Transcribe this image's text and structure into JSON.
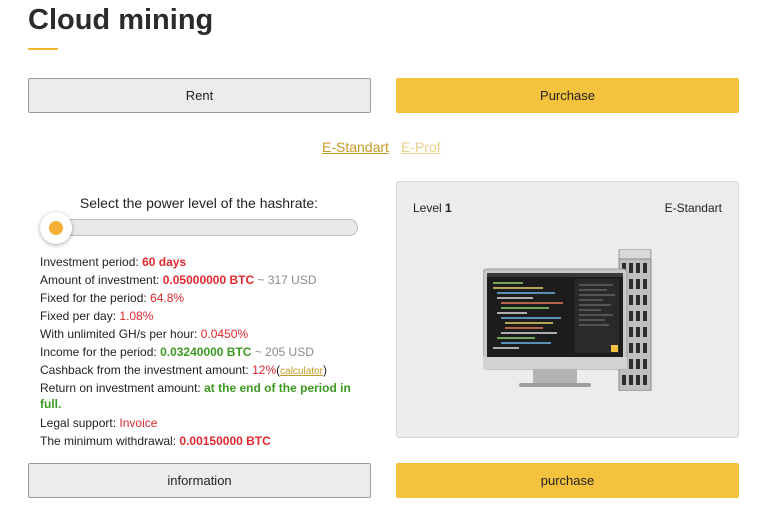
{
  "header": {
    "title": "Cloud mining"
  },
  "mode_buttons": {
    "rent": "Rent",
    "purchase": "Purchase"
  },
  "tabs": [
    {
      "label": "E-Standart",
      "active": true
    },
    {
      "label": "E-Prof",
      "active": false
    }
  ],
  "slider": {
    "title": "Select the power level of the hashrate:",
    "level_fraction": 0
  },
  "details": {
    "period_label": "Investment period:",
    "period_value": "60 days",
    "amount_label": "Amount of investment:",
    "amount_btc": "0.05000000 BTC",
    "amount_usd": "~ 317 USD",
    "fixed_period_label": "Fixed for the period:",
    "fixed_period_value": "64.8%",
    "fixed_day_label": "Fixed per day:",
    "fixed_day_value": "1.08%",
    "unlimited_label": "With unlimited GH/s per hour:",
    "unlimited_value": "0.0450%",
    "income_label": "Income for the period:",
    "income_btc": "0.03240000 BTC",
    "income_usd": "~ 205 USD",
    "cashback_label": "Cashback from the investment amount:",
    "cashback_value": "12%",
    "calculator_link": "calculator",
    "return_label": "Return on investment amount:",
    "return_value": "at the end of the period in full.",
    "legal_label": "Legal support:",
    "legal_value": "Invoice",
    "withdrawal_label": "The minimum withdrawal:",
    "withdrawal_value": "0.00150000 BTC"
  },
  "panel": {
    "level_label": "Level",
    "level_value": "1",
    "plan_name": "E-Standart",
    "image_icon": "mining-computer-image"
  },
  "bottom_buttons": {
    "information": "information",
    "purchase": "purchase"
  },
  "colors": {
    "accent": "#f4c23d",
    "red": "#e0282e",
    "green": "#3b9a1f",
    "link": "#c79a26"
  }
}
